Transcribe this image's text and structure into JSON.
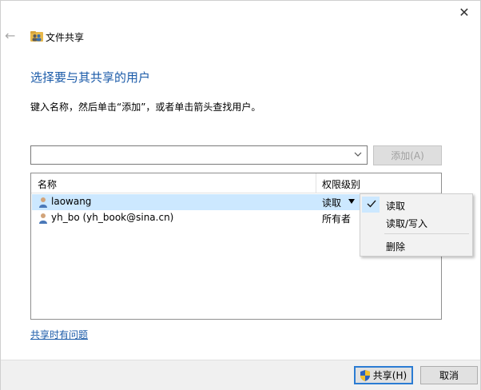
{
  "window": {
    "title": "文件共享",
    "close_glyph": "✕",
    "back_glyph": "←"
  },
  "heading": "选择要与其共享的用户",
  "instruction": "键入名称，然后单击“添加”，或者单击箭头查找用户。",
  "name_input": {
    "value": "",
    "placeholder": ""
  },
  "add_button": {
    "label": "添加(A)",
    "enabled": false
  },
  "list": {
    "columns": [
      "名称",
      "权限级别"
    ],
    "rows": [
      {
        "name": "laowang",
        "permission": "读取",
        "selected": true
      },
      {
        "name": "yh_bo (yh_book@sina.cn)",
        "permission": "所有者",
        "selected": false
      }
    ]
  },
  "permission_menu": {
    "items": [
      {
        "label": "读取",
        "checked": true
      },
      {
        "label": "读取/写入",
        "checked": false
      },
      {
        "label": "删除",
        "checked": false
      }
    ]
  },
  "problem_link": "共享时有问题",
  "footer": {
    "share_label": "共享(H)",
    "cancel_label": "取消"
  },
  "colors": {
    "accent": "#1a5aa8",
    "selection": "#cce8ff",
    "default_button_border": "#2b7cd3"
  },
  "icons": [
    "close-icon",
    "back-arrow-icon",
    "share-folder-icon",
    "chevron-down-icon",
    "user-icon",
    "checkmark-icon",
    "uac-shield-icon"
  ]
}
